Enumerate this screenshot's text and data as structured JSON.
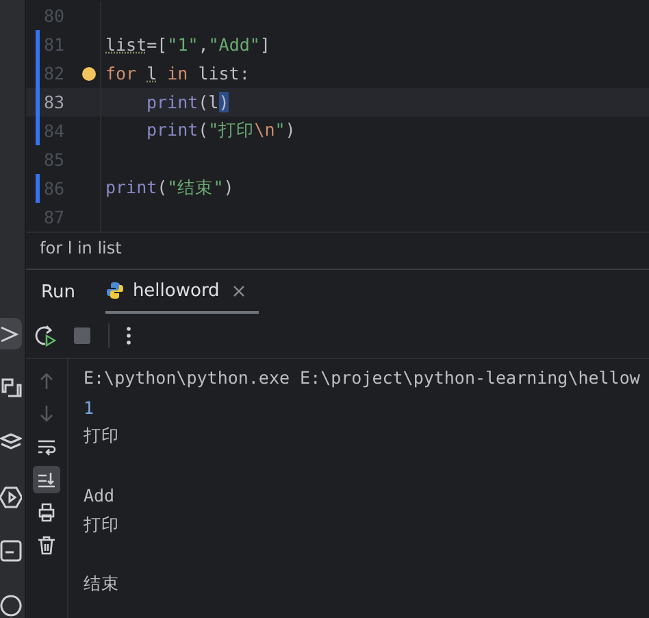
{
  "tool_strip": [
    {
      "selected": true
    },
    {
      "selected": false
    },
    {
      "selected": false
    },
    {
      "selected": false
    },
    {
      "selected": false
    },
    {
      "selected": false
    }
  ],
  "editor": {
    "lines": [
      {
        "number": "80",
        "current": false,
        "changed": false,
        "indented": false,
        "bulb": false
      },
      {
        "number": "81",
        "current": false,
        "changed": true,
        "indented": false,
        "bulb": false,
        "tokens": [
          {
            "text": "list",
            "kind": "warn",
            "space_before": false
          },
          {
            "text": "=[",
            "kind": "plain",
            "space_before": false
          },
          {
            "text": "\"1\"",
            "kind": "string",
            "space_before": false
          },
          {
            "text": ",",
            "kind": "plain",
            "space_before": false
          },
          {
            "text": "\"Add\"",
            "kind": "string",
            "space_before": false
          },
          {
            "text": "]",
            "kind": "plain",
            "space_before": false
          }
        ]
      },
      {
        "number": "82",
        "current": false,
        "changed": true,
        "indented": false,
        "bulb": true,
        "tokens": [
          {
            "text": "for",
            "kind": "keyword",
            "space_before": false
          },
          {
            "text": "l",
            "kind": "warn",
            "space_before": true
          },
          {
            "text": "in",
            "kind": "keyword",
            "space_before": true
          },
          {
            "text": "list:",
            "kind": "plain",
            "space_before": true
          }
        ]
      },
      {
        "number": "83",
        "current": true,
        "changed": true,
        "indented": true,
        "bulb": false,
        "tokens": [
          {
            "text": "print",
            "kind": "builtin",
            "space_before": false
          },
          {
            "text": "(l",
            "kind": "plain",
            "space_before": false
          },
          {
            "text": ")",
            "kind": "match",
            "space_before": false
          }
        ]
      },
      {
        "number": "84",
        "current": false,
        "changed": true,
        "indented": true,
        "bulb": false,
        "tokens": [
          {
            "text": "print",
            "kind": "builtin",
            "space_before": false
          },
          {
            "text": "(",
            "kind": "plain",
            "space_before": false
          },
          {
            "text": "\"打印",
            "kind": "string",
            "space_before": false
          },
          {
            "text": "\\n",
            "kind": "escape",
            "space_before": false
          },
          {
            "text": "\"",
            "kind": "string",
            "space_before": false
          },
          {
            "text": ")",
            "kind": "plain",
            "space_before": false
          }
        ]
      },
      {
        "number": "85",
        "current": false,
        "changed": false,
        "indented": false,
        "bulb": false
      },
      {
        "number": "86",
        "current": false,
        "changed": true,
        "indented": false,
        "bulb": false,
        "tokens": [
          {
            "text": "print",
            "kind": "builtin",
            "space_before": false
          },
          {
            "text": "(",
            "kind": "plain",
            "space_before": false
          },
          {
            "text": "\"结束\"",
            "kind": "string",
            "space_before": false
          },
          {
            "text": ")",
            "kind": "plain",
            "space_before": false
          }
        ]
      },
      {
        "number": "87",
        "current": false,
        "changed": false,
        "indented": false,
        "bulb": false
      }
    ],
    "breadcrumb": "for l in list"
  },
  "run_panel": {
    "title": "Run",
    "tabs": [
      {
        "label": "helloword",
        "selected": true
      }
    ],
    "side_buttons": [
      {
        "selected": false,
        "disabled": true
      },
      {
        "selected": false,
        "disabled": true
      },
      {
        "selected": false,
        "disabled": false
      },
      {
        "selected": true,
        "disabled": false
      },
      {
        "selected": false,
        "disabled": false
      },
      {
        "selected": false,
        "disabled": false
      }
    ],
    "output": [
      {
        "text": "E:\\python\\python.exe E:\\project\\python-learning\\hellow",
        "kind": "command",
        "blank_before": false
      },
      {
        "text": "1",
        "kind": "number",
        "blank_before": false
      },
      {
        "text": "打印",
        "kind": "out",
        "blank_before": false
      },
      {
        "text": "Add",
        "kind": "out",
        "blank_before": true
      },
      {
        "text": "打印",
        "kind": "out",
        "blank_before": false
      },
      {
        "text": "结束",
        "kind": "out",
        "blank_before": true
      }
    ]
  }
}
